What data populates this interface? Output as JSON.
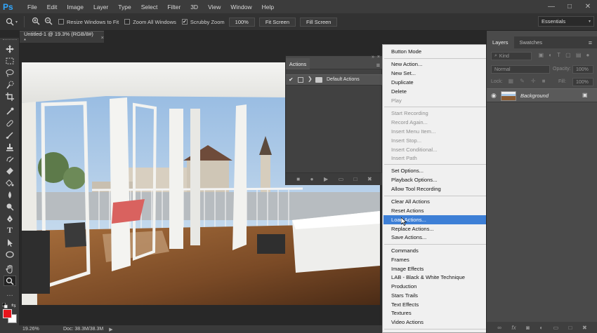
{
  "app": {
    "logo": "Ps"
  },
  "menubar": {
    "items": [
      "File",
      "Edit",
      "Image",
      "Layer",
      "Type",
      "Select",
      "Filter",
      "3D",
      "View",
      "Window",
      "Help"
    ],
    "window_controls": [
      "minimize-icon",
      "maximize-icon",
      "close-icon"
    ]
  },
  "options_bar": {
    "resize_windows": {
      "label": "Resize Windows to Fit",
      "checked": false
    },
    "zoom_all": {
      "label": "Zoom All Windows",
      "checked": false
    },
    "scrubby": {
      "label": "Scrubby Zoom",
      "checked": true
    },
    "btn_100": "100%",
    "btn_fit": "Fit Screen",
    "btn_fill": "Fill Screen",
    "workspace": "Essentials"
  },
  "document": {
    "tab_title": "Untitled-1 @ 19.3% (RGB/8#) *",
    "zoom": "19.26%",
    "doc_info": "Doc: 38.3M/38.3M"
  },
  "actions_panel": {
    "tab": "Actions",
    "set_name": "Default Actions"
  },
  "flyout": {
    "items": [
      {
        "label": "Button Mode",
        "state": "normal"
      },
      {
        "label": "New Action...",
        "state": "normal"
      },
      {
        "label": "New Set...",
        "state": "normal"
      },
      {
        "label": "Duplicate",
        "state": "normal"
      },
      {
        "label": "Delete",
        "state": "normal"
      },
      {
        "label": "Play",
        "state": "disabled"
      },
      {
        "label": "Start Recording",
        "state": "disabled"
      },
      {
        "label": "Record Again...",
        "state": "disabled"
      },
      {
        "label": "Insert Menu Item...",
        "state": "disabled"
      },
      {
        "label": "Insert Stop...",
        "state": "disabled"
      },
      {
        "label": "Insert Conditional...",
        "state": "disabled"
      },
      {
        "label": "Insert Path",
        "state": "disabled"
      },
      {
        "label": "Set Options...",
        "state": "normal"
      },
      {
        "label": "Playback Options...",
        "state": "normal"
      },
      {
        "label": "Allow Tool Recording",
        "state": "normal"
      },
      {
        "label": "Clear All Actions",
        "state": "normal"
      },
      {
        "label": "Reset Actions",
        "state": "normal"
      },
      {
        "label": "Load Actions...",
        "state": "highlighted"
      },
      {
        "label": "Replace Actions...",
        "state": "normal"
      },
      {
        "label": "Save Actions...",
        "state": "normal"
      },
      {
        "label": "Commands",
        "state": "normal"
      },
      {
        "label": "Frames",
        "state": "normal"
      },
      {
        "label": "Image Effects",
        "state": "normal"
      },
      {
        "label": "LAB - Black & White Technique",
        "state": "normal"
      },
      {
        "label": "Production",
        "state": "normal"
      },
      {
        "label": "Stars Trails",
        "state": "normal"
      },
      {
        "label": "Text Effects",
        "state": "normal"
      },
      {
        "label": "Textures",
        "state": "normal"
      },
      {
        "label": "Video Actions",
        "state": "normal"
      }
    ],
    "highlight_color": "#3d7fd6"
  },
  "layers_panel": {
    "tabs": [
      "Layers",
      "Swatches"
    ],
    "kind_label": "Kind",
    "blend_mode": "Normal",
    "opacity_label": "Opacity:",
    "opacity_value": "100%",
    "lock_label": "Lock:",
    "fill_label": "Fill:",
    "fill_value": "100%",
    "layer_name": "Background"
  },
  "colors": {
    "foreground": "#e8141c",
    "background": "#ffffff"
  }
}
